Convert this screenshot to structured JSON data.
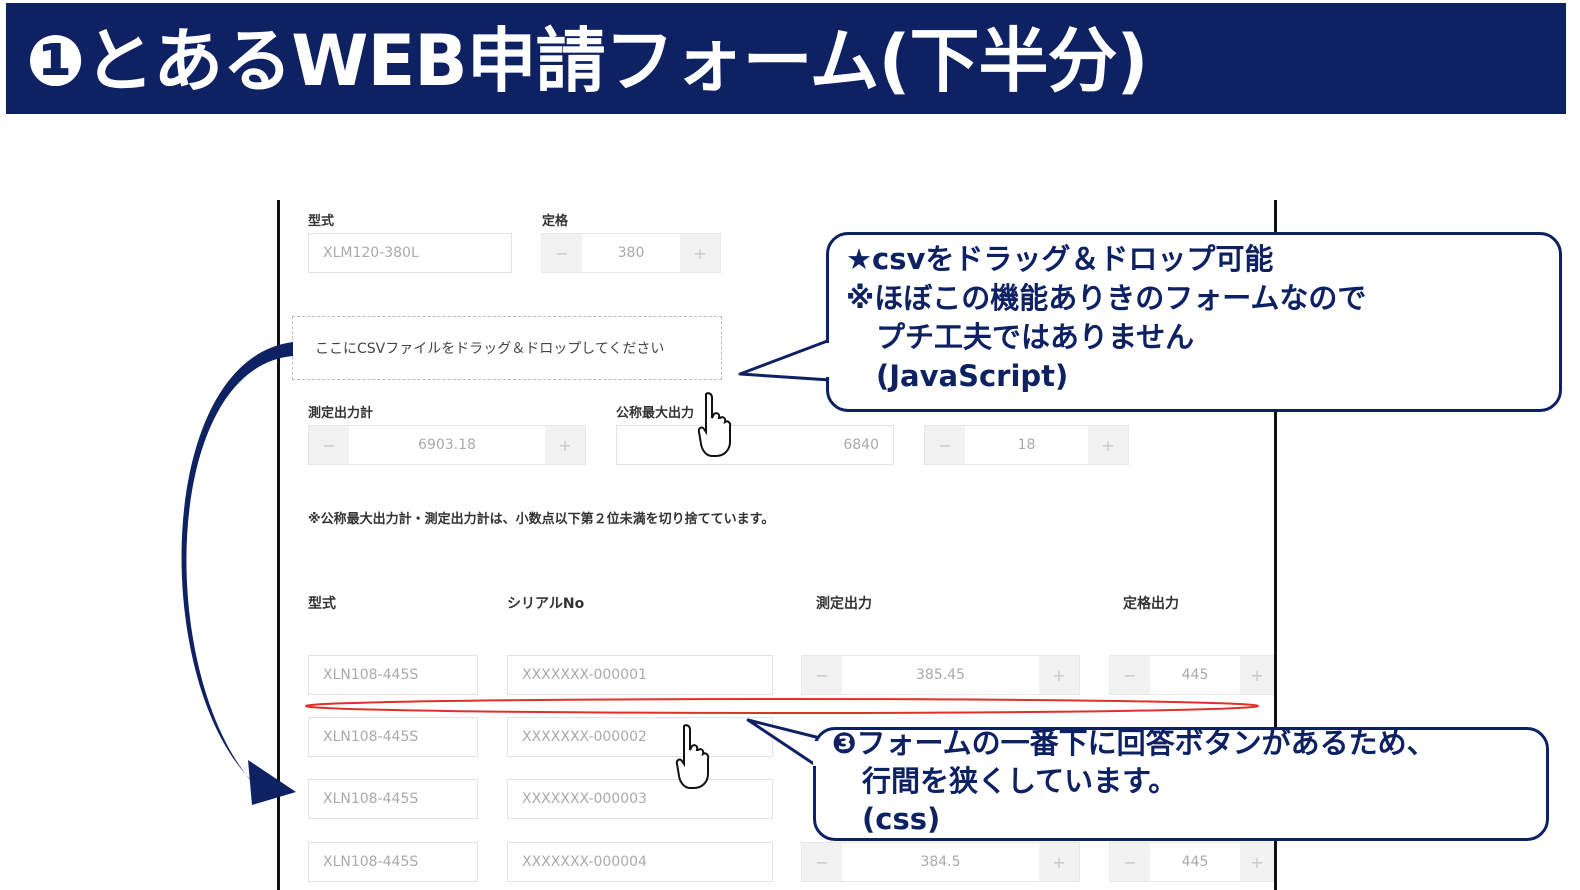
{
  "slide": {
    "title": "❶とあるWEB申請フォーム(下半分)"
  },
  "form": {
    "model_label": "型式",
    "model_value": "XLM120-380L",
    "rating_label": "定格",
    "rating_value": "380",
    "dropzone_text": "ここにCSVファイルをドラッグ＆ドロップしてください",
    "measured_total_label": "測定出力計",
    "measured_total_value": "6903.18",
    "nominal_max_label": "公称最大出力",
    "nominal_max_value": "6840",
    "count_value": "18",
    "note": "※公称最大出力計・測定出力計は、小数点以下第２位未満を切り捨てています。",
    "table_headers": {
      "model": "型式",
      "serial": "シリアルNo",
      "measured": "測定出力",
      "rated": "定格出力"
    },
    "rows": [
      {
        "model": "XLN108-445S",
        "serial": "XXXXXXX-000001",
        "measured": "385.45",
        "rated": "445"
      },
      {
        "model": "XLN108-445S",
        "serial": "XXXXXXX-000002"
      },
      {
        "model": "XLN108-445S",
        "serial": "XXXXXXX-000003"
      },
      {
        "model": "XLN108-445S",
        "serial": "XXXXXXX-000004",
        "measured": "384.5",
        "rated": "445"
      }
    ],
    "minus": "−",
    "plus": "+"
  },
  "callout_top": {
    "line1": "★csvをドラッグ＆ドロップ可能",
    "line2": "※ほぼこの機能ありきのフォームなので",
    "line3": "プチ工夫ではありません",
    "line4": "(JavaScript)"
  },
  "callout_bottom": {
    "line1": "❸フォームの一番下に回答ボタンがあるため、",
    "line2": "行間を狭くしています。",
    "line3": "(css)"
  },
  "colors": {
    "navy": "#0d2163",
    "highlight_red": "#e0302a"
  }
}
